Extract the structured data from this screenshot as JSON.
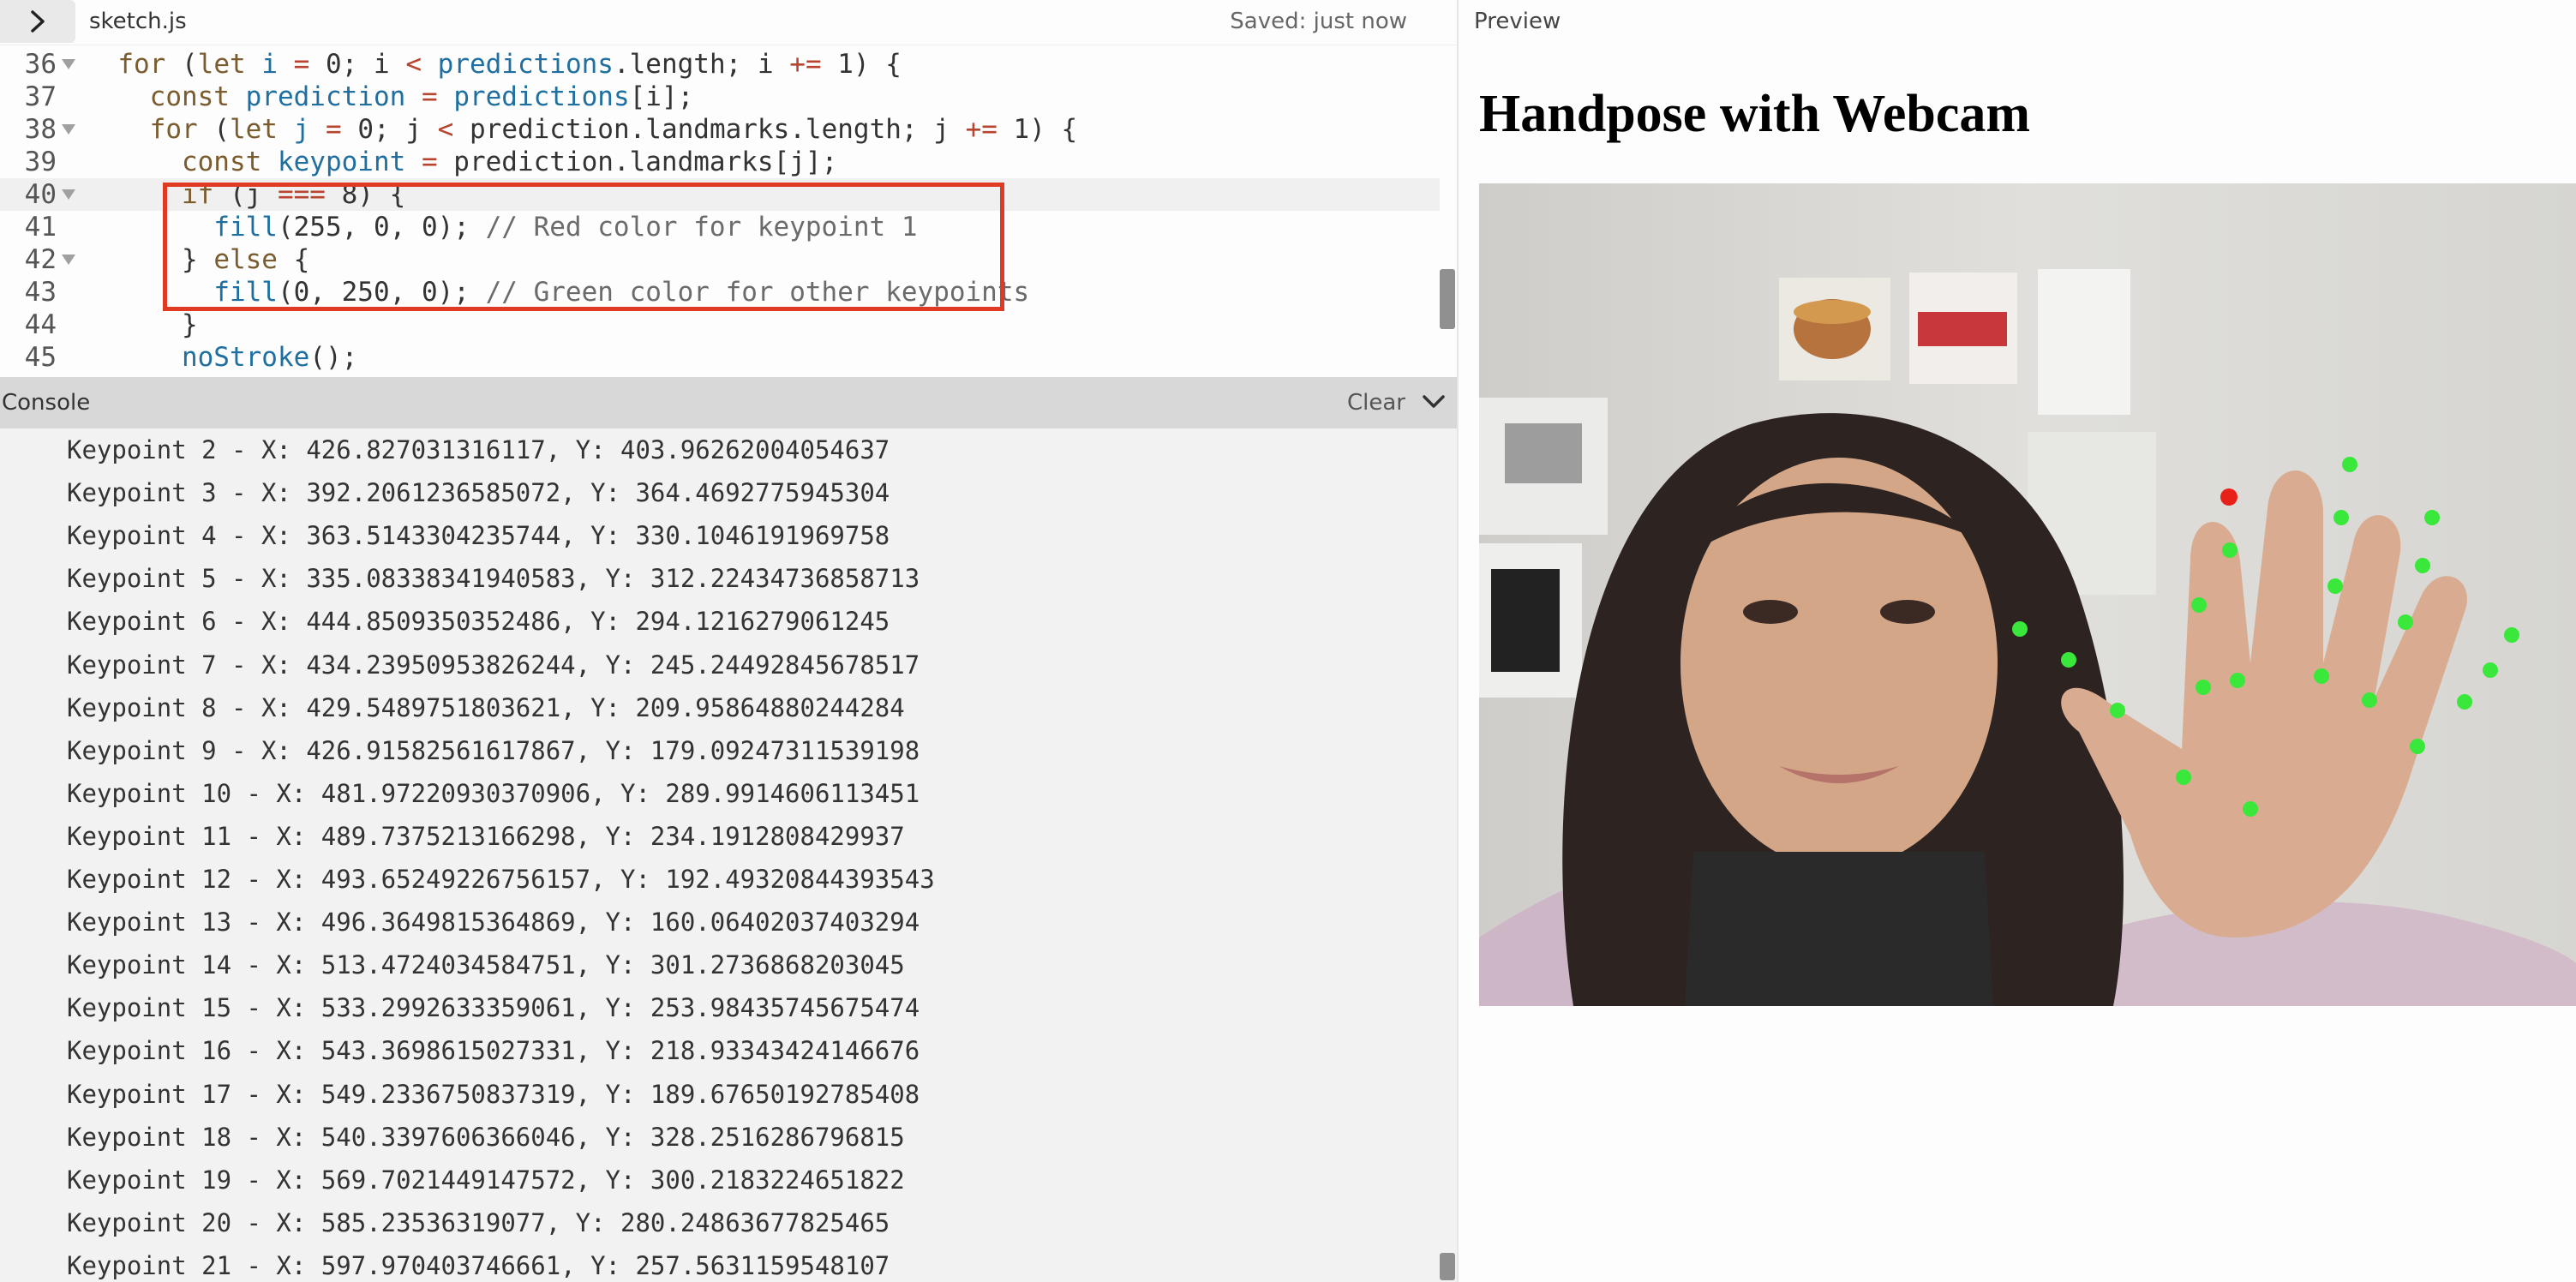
{
  "editor": {
    "file_name": "sketch.js",
    "save_status": "Saved: just now",
    "lines": [
      {
        "n": "36",
        "text": "  for (let i = 0; i < predictions.length; i += 1) {"
      },
      {
        "n": "37",
        "text": "    const prediction = predictions[i];"
      },
      {
        "n": "38",
        "text": "    for (let j = 0; j < prediction.landmarks.length; j += 1) {"
      },
      {
        "n": "39",
        "text": "      const keypoint = prediction.landmarks[j];"
      },
      {
        "n": "40",
        "text": "      if (j === 8) {"
      },
      {
        "n": "41",
        "text": "        fill(255, 0, 0); // Red color for keypoint 1"
      },
      {
        "n": "42",
        "text": "      } else {"
      },
      {
        "n": "43",
        "text": "        fill(0, 250, 0); // Green color for other keypoints"
      },
      {
        "n": "44",
        "text": "      }"
      },
      {
        "n": "45",
        "text": "      noStroke();"
      }
    ]
  },
  "console": {
    "title": "Console",
    "clear_label": "Clear",
    "logs": [
      "Keypoint 2 - X: 426.827031316117, Y: 403.96262004054637",
      "Keypoint 3 - X: 392.2061236585072, Y: 364.4692775945304",
      "Keypoint 4 - X: 363.5143304235744, Y: 330.1046191969758",
      "Keypoint 5 - X: 335.08338341940583, Y: 312.22434736858713",
      "Keypoint 6 - X: 444.8509350352486, Y: 294.1216279061245",
      "Keypoint 7 - X: 434.23950953826244, Y: 245.24492845678517",
      "Keypoint 8 - X: 429.5489751803621, Y: 209.95864880244284",
      "Keypoint 9 - X: 426.91582561617867, Y: 179.09247311539198",
      "Keypoint 10 - X: 481.97220930370906, Y: 289.9914606113451",
      "Keypoint 11 - X: 489.7375213166298, Y: 234.1912808429937",
      "Keypoint 12 - X: 493.65249226756157, Y: 192.49320844393543",
      "Keypoint 13 - X: 496.3649815364869, Y: 160.06402037403294",
      "Keypoint 14 - X: 513.4724034584751, Y: 301.2736868203045",
      "Keypoint 15 - X: 533.2992633359061, Y: 253.98435745675474",
      "Keypoint 16 - X: 543.3698615027331, Y: 218.93343424146676",
      "Keypoint 17 - X: 549.2336750837319, Y: 189.67650192785408",
      "Keypoint 18 - X: 540.3397606366046, Y: 328.2516286796815",
      "Keypoint 19 - X: 569.7021449147572, Y: 300.2183224651822",
      "Keypoint 20 - X: 585.23536319077, Y: 280.24863677825465",
      "Keypoint 21 - X: 597.970403746661, Y: 257.5631159548107"
    ]
  },
  "preview": {
    "label": "Preview",
    "title": "Handpose with Webcam"
  },
  "colors": {
    "highlight_box": "#e03b22",
    "keypoint_red": "#ff0000",
    "keypoint_green": "#00fa00"
  },
  "icons": [
    "chevron-right-icon",
    "chevron-down-icon",
    "fold-arrow-icon"
  ]
}
